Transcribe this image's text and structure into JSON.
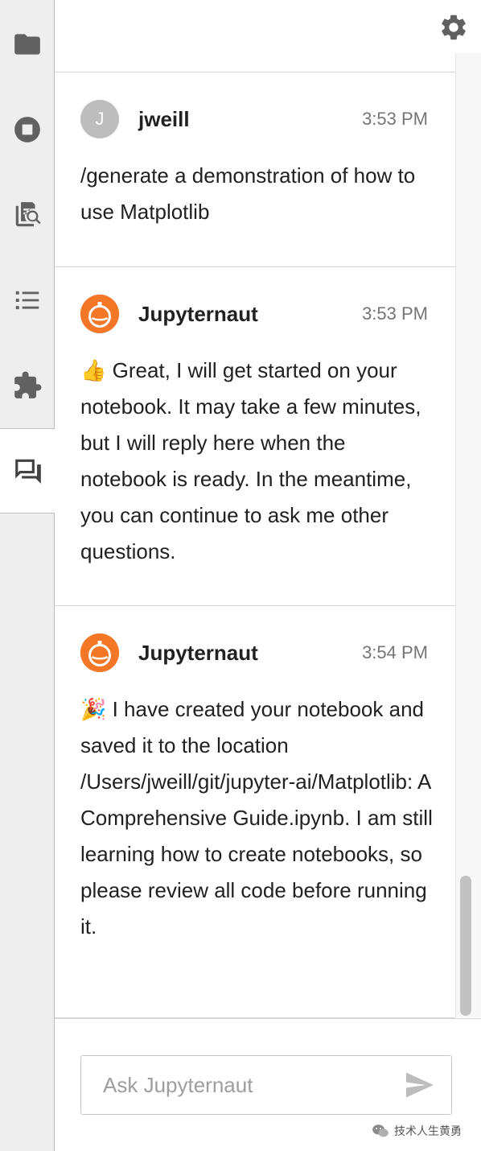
{
  "sidebar": {
    "items": [
      {
        "name": "file-browser",
        "icon": "folder-icon"
      },
      {
        "name": "running-kernels",
        "icon": "stop-circle-icon"
      },
      {
        "name": "property-inspector",
        "icon": "document-search-icon"
      },
      {
        "name": "table-of-contents",
        "icon": "list-icon"
      },
      {
        "name": "extension-manager",
        "icon": "puzzle-icon"
      },
      {
        "name": "chat",
        "icon": "chat-icon",
        "active": true
      }
    ]
  },
  "header": {
    "settings_icon": "gear-icon"
  },
  "messages": [
    {
      "sender": "jweill",
      "avatar_letter": "J",
      "avatar_color": "#bdbdbd",
      "time": "3:53 PM",
      "text": "/generate a demonstration of how to use Matplotlib"
    },
    {
      "sender": "Jupyternaut",
      "avatar_icon": "jupyternaut-icon",
      "avatar_color": "#f37726",
      "time": "3:53 PM",
      "emoji": "👍",
      "text": "Great, I will get started on your notebook. It may take a few minutes, but I will reply here when the notebook is ready. In the meantime, you can continue to ask me other questions."
    },
    {
      "sender": "Jupyternaut",
      "avatar_icon": "jupyternaut-icon",
      "avatar_color": "#f37726",
      "time": "3:54 PM",
      "emoji": "🎉",
      "text": "I have created your notebook and saved it to the location /Users/jweill/git/jupyter-ai/Matplotlib: A Comprehensive Guide.ipynb. I am still learning how to create notebooks, so please review all code before running it."
    }
  ],
  "input": {
    "placeholder": "Ask Jupyternaut",
    "value": "",
    "send_icon": "send-icon"
  },
  "watermark": {
    "text": "技术人生黄勇",
    "icon": "wechat-icon"
  }
}
